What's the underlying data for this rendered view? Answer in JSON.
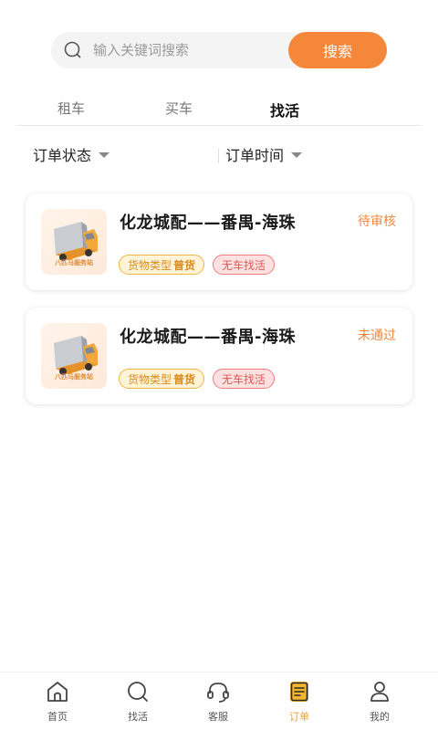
{
  "search": {
    "placeholder": "输入关键词搜索",
    "button_label": "搜索"
  },
  "tabs": [
    {
      "label": "租车"
    },
    {
      "label": "买车"
    },
    {
      "label": "找活",
      "active": true
    }
  ],
  "filters": [
    {
      "label": "订单状态"
    },
    {
      "label": "订单时间"
    }
  ],
  "orders": [
    {
      "title": "化龙城配——番禺-海珠",
      "status": "待审核",
      "cargo_type_label": "货物类型",
      "cargo_type_value": "普货",
      "tag": "无车找活",
      "thumb_caption": "八匹马服务站"
    },
    {
      "title": "化龙城配——番禺-海珠",
      "status": "未通过",
      "cargo_type_label": "货物类型",
      "cargo_type_value": "普货",
      "tag": "无车找活",
      "thumb_caption": "八匹马服务站"
    }
  ],
  "nav": [
    {
      "label": "首页",
      "icon": "home-icon"
    },
    {
      "label": "找活",
      "icon": "search-icon"
    },
    {
      "label": "客服",
      "icon": "headset-icon"
    },
    {
      "label": "订单",
      "icon": "order-icon",
      "active": true
    },
    {
      "label": "我的",
      "icon": "user-icon"
    }
  ],
  "colors": {
    "accent": "#f5873b",
    "active_nav": "#f0a21d",
    "status": "#f0883c",
    "tab_underline": "#f5b52e"
  }
}
